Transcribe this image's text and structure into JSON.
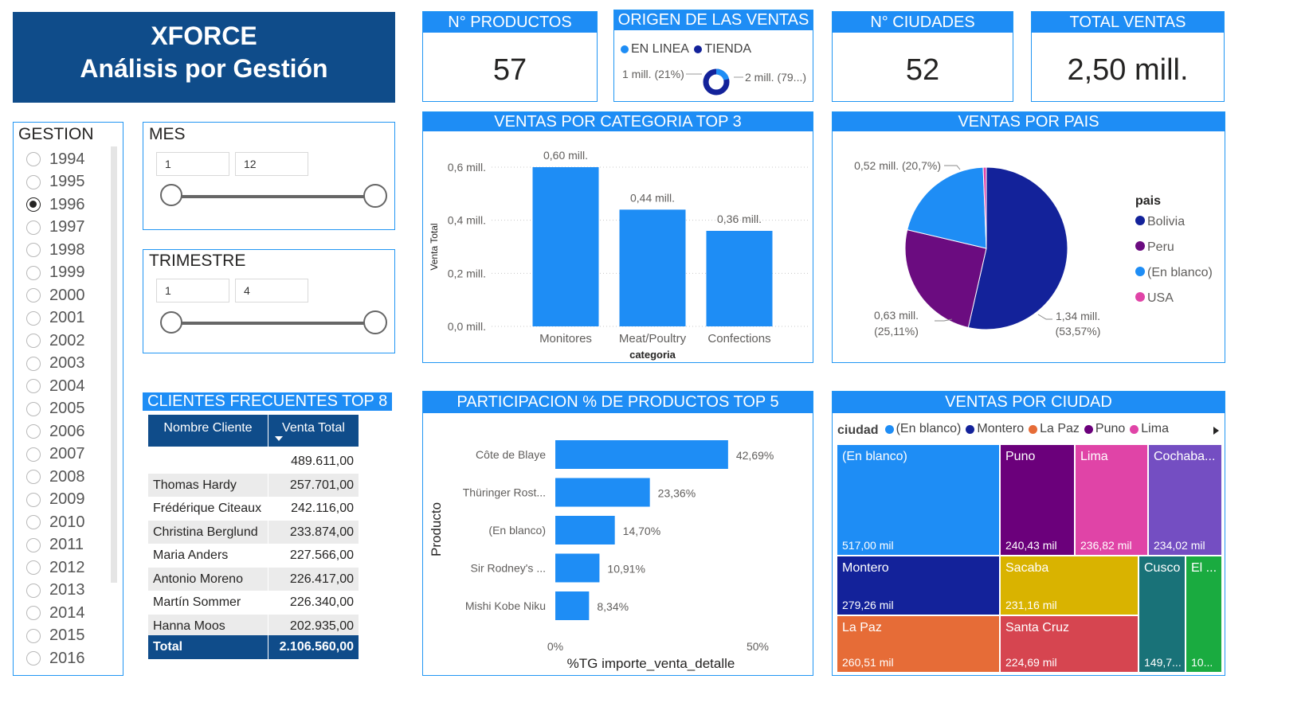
{
  "header": {
    "title_line1": "XFORCE",
    "title_line2": "Análisis por Gestión",
    "bg": "#0f4c8a"
  },
  "kpis": [
    {
      "title": "N° PRODUCTOS",
      "value": "57"
    },
    {
      "title": "N° CIUDADES",
      "value": "52"
    },
    {
      "title": "TOTAL VENTAS",
      "value": "2,50 mill."
    }
  ],
  "origen": {
    "title": "ORIGEN DE LAS VENTAS",
    "legend": [
      {
        "label": "EN LINEA",
        "color": "#1e8df5"
      },
      {
        "label": "TIENDA",
        "color": "#13229a"
      }
    ],
    "left_label": "1 mill. (21%)",
    "right_label": "2 mill. (79...)",
    "share_en_linea": 0.21
  },
  "gestion": {
    "title": "GESTION",
    "years": [
      "1994",
      "1995",
      "1996",
      "1997",
      "1998",
      "1999",
      "2000",
      "2001",
      "2002",
      "2003",
      "2004",
      "2005",
      "2006",
      "2007",
      "2008",
      "2009",
      "2010",
      "2011",
      "2012",
      "2013",
      "2014",
      "2015",
      "2016"
    ],
    "selected": "1996"
  },
  "mes": {
    "title": "MES",
    "min": "1",
    "max": "12"
  },
  "trimestre": {
    "title": "TRIMESTRE",
    "min": "1",
    "max": "4"
  },
  "clientes": {
    "title": "CLIENTES FRECUENTES TOP 8",
    "col1": "Nombre Cliente",
    "col2": "Venta Total",
    "rows": [
      {
        "name": "",
        "value": "489.611,00"
      },
      {
        "name": "Thomas Hardy",
        "value": "257.701,00"
      },
      {
        "name": "Frédérique Citeaux",
        "value": "242.116,00"
      },
      {
        "name": "Christina Berglund",
        "value": "233.874,00"
      },
      {
        "name": "Maria Anders",
        "value": "227.566,00"
      },
      {
        "name": "Antonio Moreno",
        "value": "226.417,00"
      },
      {
        "name": "Martín Sommer",
        "value": "226.340,00"
      },
      {
        "name": "Hanna Moos",
        "value": "202.935,00"
      }
    ],
    "total_label": "Total",
    "total_value": "2.106.560,00"
  },
  "chart_data": [
    {
      "type": "bar",
      "title": "VENTAS POR CATEGORIA TOP 3",
      "xlabel": "categoria",
      "ylabel": "Venta Total",
      "categories": [
        "Monitores",
        "Meat/Poultry",
        "Confections"
      ],
      "values": [
        0.6,
        0.44,
        0.36
      ],
      "data_labels": [
        "0,60 mill.",
        "0,44 mill.",
        "0,36 mill."
      ],
      "yticks": [
        {
          "v": 0.0,
          "label": "0,0 mill."
        },
        {
          "v": 0.2,
          "label": "0,2 mill."
        },
        {
          "v": 0.4,
          "label": "0,4 mill."
        },
        {
          "v": 0.6,
          "label": "0,6 mill."
        }
      ],
      "ylim": [
        0,
        0.6
      ],
      "color": "#1e8df5"
    },
    {
      "type": "pie",
      "title": "VENTAS POR PAIS",
      "legend_title": "pais",
      "slices": [
        {
          "name": "Bolivia",
          "value": 53.57,
          "color": "#13229a",
          "label": "1,34 mill.",
          "pct": "(53,57%)"
        },
        {
          "name": "Peru",
          "value": 25.11,
          "color": "#6b0c80",
          "label": "0,63 mill.",
          "pct": "(25,11%)"
        },
        {
          "name": "(En blanco)",
          "value": 20.7,
          "color": "#1e8df5",
          "label": "0,52 mill. (20,7%)",
          "pct": ""
        },
        {
          "name": "USA",
          "value": 0.62,
          "color": "#e044a7",
          "label": "",
          "pct": ""
        }
      ]
    },
    {
      "type": "bar",
      "orientation": "horizontal",
      "title": "PARTICIPACION % DE PRODUCTOS TOP 5",
      "ylabel": "Producto",
      "xlabel": "%TG importe_venta_detalle",
      "categories": [
        "Côte de Blaye",
        "Thüringer Rost...",
        "(En blanco)",
        "Sir Rodney's ...",
        "Mishi Kobe Niku"
      ],
      "values": [
        42.69,
        23.36,
        14.7,
        10.91,
        8.34
      ],
      "data_labels": [
        "42,69%",
        "23,36%",
        "14,70%",
        "10,91%",
        "8,34%"
      ],
      "xticks": [
        {
          "v": 0,
          "label": "0%"
        },
        {
          "v": 50,
          "label": "50%"
        }
      ],
      "xlim": [
        0,
        50
      ],
      "color": "#1e8df5"
    },
    {
      "type": "treemap",
      "title": "VENTAS POR CIUDAD",
      "legend_title": "ciudad",
      "legend": [
        {
          "label": "(En blanco)",
          "color": "#1e8df5"
        },
        {
          "label": "Montero",
          "color": "#13229a"
        },
        {
          "label": "La Paz",
          "color": "#e66c37"
        },
        {
          "label": "Puno",
          "color": "#6b007b"
        },
        {
          "label": "Lima",
          "color": "#e044a7"
        }
      ],
      "tiles": [
        {
          "name": "(En blanco)",
          "label": "517,00 mil",
          "value": 517.0,
          "color": "#1e8df5"
        },
        {
          "name": "Puno",
          "label": "240,43 mil",
          "value": 240.43,
          "color": "#6b007b"
        },
        {
          "name": "Lima",
          "label": "236,82 mil",
          "value": 236.82,
          "color": "#e044a7"
        },
        {
          "name": "Cochaba...",
          "label": "234,02 mil",
          "value": 234.02,
          "color": "#744ec2"
        },
        {
          "name": "Montero",
          "label": "279,26 mil",
          "value": 279.26,
          "color": "#13229a"
        },
        {
          "name": "Sacaba",
          "label": "231,16 mil",
          "value": 231.16,
          "color": "#d9b300"
        },
        {
          "name": "Cusco",
          "label": "149,7...",
          "value": 149.7,
          "color": "#197278"
        },
        {
          "name": "El ...",
          "label": "10...",
          "value": null,
          "color": "#1aab40"
        },
        {
          "name": "La Paz",
          "label": "260,51 mil",
          "value": 260.51,
          "color": "#e66c37"
        },
        {
          "name": "Santa Cruz",
          "label": "224,69 mil",
          "value": 224.69,
          "color": "#d64550"
        }
      ]
    }
  ]
}
